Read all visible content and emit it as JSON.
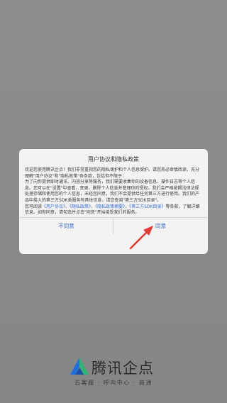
{
  "dialog": {
    "title": "用户协议和隐私政策",
    "para1": "欢迎您使用腾讯企点！我们非常重视您的隐私保护和个人信息保护。请您务必审慎阅读、充分理解\"用户协议\"和\"隐私政策\"各条款，包括但不限于：",
    "para2": "为了向你提供即时通讯、内容分享等服务，我们需要收集你的设备信息、操作日志等个人信息。您可以在\"设置\"中查看、变更、删除个人信息并管理你的授权。我们会严格按照法律法规处理存储和使用您的个人信息，未经您同意，我们不会提供给任何第三方进行使用。我们的产品中接入的第三方SDK类服务有具体信息，请您查阅\"第三方SDK目录\"。",
    "para3_prefix": "您可阅读",
    "link_user_agreement": "《用户协议》",
    "link_privacy_policy": "《隐私政策》",
    "link_privacy_summary": "《隐私政策摘要》",
    "link_sdk_list": "《第三方SDK目录》",
    "para3_suffix": "等条款，了解详细信息。如你同意，请勾选并点击\"同意\"开始接受我们的服务。",
    "disagree_label": "不同意",
    "agree_label": "同意"
  },
  "brand": {
    "name": "腾讯企点",
    "tagline": "云客服 · 呼叫中心 · 商通"
  },
  "colors": {
    "accent": "#3f6fd1",
    "annotation_arrow": "#e53935",
    "logo_blue": "#1e6fe0",
    "logo_green": "#2bb673"
  }
}
